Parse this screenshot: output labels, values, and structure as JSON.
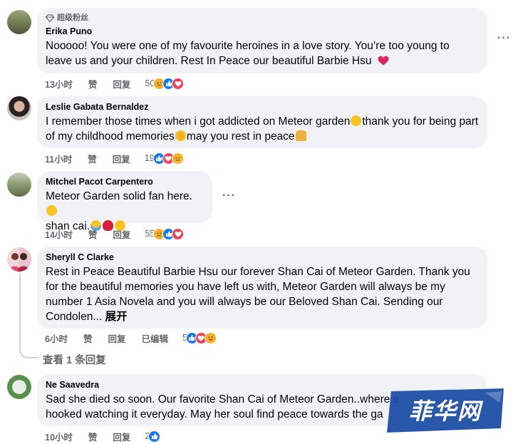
{
  "comments": [
    {
      "badge": "超级粉丝",
      "author": "Erika Puno",
      "text": "Nooooo! You were one of my favourite heroines in a love story. You’re too young to leave us and your children. Rest In Peace our beautiful Barbie Hsu",
      "time": "13小时",
      "like": "赞",
      "reply": "回复",
      "reaction_count": "50"
    },
    {
      "author": "Leslie Gabata Bernaldez",
      "text_a": "I remember those times when i got addicted on Meteor garden",
      "text_b": "thank you for being part of my childhood memories",
      "text_c": "may you rest in peace",
      "time": "11小时",
      "like": "赞",
      "reply": "回复",
      "reaction_count": "19"
    },
    {
      "author": "Mitchel Pacot Carpentero",
      "text_a": "Meteor Garden solid fan here.",
      "text_b": "shan cai.",
      "time": "14小时",
      "like": "赞",
      "reply": "回复",
      "reaction_count": "55"
    },
    {
      "author": "Sheryll C Clarke",
      "text": "Rest in Peace Beautiful Barbie Hsu our forever Shan Cai of Meteor Garden. Thank you for the beautiful memories you have left us with, Meteor Garden will always be my number 1 Asia Novela and you will always be our Beloved Shan Cai. Sending our Condolen...",
      "expand": "展开",
      "time": "6小时",
      "like": "赞",
      "reply": "回复",
      "edited": "已编辑",
      "reaction_count": "5",
      "view_replies": "查看 1 条回复"
    },
    {
      "author": "Ne Saavedra",
      "text": "Sad she died so soon. Our favorite Shan Cai of Meteor Garden..where e hooked watching it everyday. May her soul find peace towards the ga",
      "time": "10小时",
      "like": "赞",
      "reply": "回复",
      "reaction_count": "2"
    }
  ],
  "more_icon": "more-dots-icon",
  "watermark": {
    "text": "菲华网",
    "color": "#1d4fa5"
  },
  "colors": {
    "like_blue": "#1877f2",
    "love_red": "#f33e58",
    "haha_yellow": "#f7b125",
    "bubble": "#f0f2f5",
    "meta_gray": "#65676b"
  }
}
